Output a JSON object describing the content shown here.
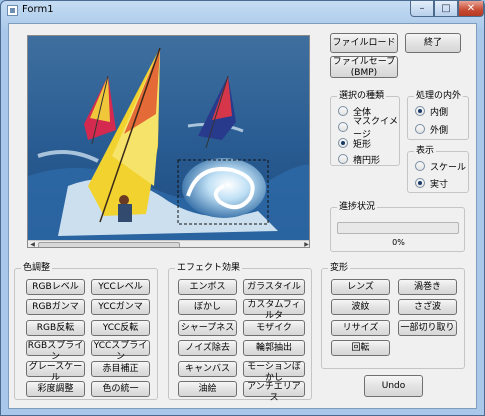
{
  "window": {
    "title": "Form1",
    "controls": {
      "minimize": "–",
      "maximize": "□",
      "close": "✕"
    }
  },
  "buttons": {
    "file_load": "ファイルロード",
    "file_save_line1": "ファイルセーブ",
    "file_save_line2": "(BMP)",
    "exit": "終了",
    "undo": "Undo"
  },
  "selection_type": {
    "label": "選択の種類",
    "options": [
      "全体",
      "マスクイメージ",
      "矩形",
      "楕円形"
    ],
    "selected": "矩形"
  },
  "process_area": {
    "label": "処理の内外",
    "options": [
      "内側",
      "外側"
    ],
    "selected": "内側"
  },
  "display": {
    "label": "表示",
    "options": [
      "スケール",
      "実寸"
    ],
    "selected": "実寸"
  },
  "progress": {
    "label": "進捗状況",
    "value": 0,
    "text": "0%"
  },
  "color_adjust": {
    "label": "色調整",
    "buttons": [
      "RGBレベル",
      "YCCレベル",
      "RGBガンマ",
      "YCCガンマ",
      "RGB反転",
      "YCC反転",
      "RGBスプライン",
      "YCCスプライン",
      "グレースケール",
      "赤目補正",
      "彩度調整",
      "色の統一"
    ]
  },
  "effects": {
    "label": "エフェクト効果",
    "buttons": [
      "エンボス",
      "ガラスタイル",
      "ぼかし",
      "カスタムフィルタ",
      "シャープネス",
      "モザイク",
      "ノイズ除去",
      "輪郭抽出",
      "キャンバス",
      "モーションぼかし",
      "油絵",
      "アンチエリアス"
    ]
  },
  "transform": {
    "label": "変形",
    "buttons": [
      "レンズ",
      "渦巻き",
      "波紋",
      "さざ波",
      "リサイズ",
      "一部切り取り",
      "回転"
    ]
  },
  "icons": {
    "scroll_up": "arrow-up-icon",
    "scroll_down": "arrow-down-icon",
    "scroll_left": "arrow-left-icon",
    "scroll_right": "arrow-right-icon"
  },
  "colors": {
    "title_bar": "#a9c8e9",
    "client_bg": "#f0f0f0",
    "close_button": "#c84a32"
  }
}
